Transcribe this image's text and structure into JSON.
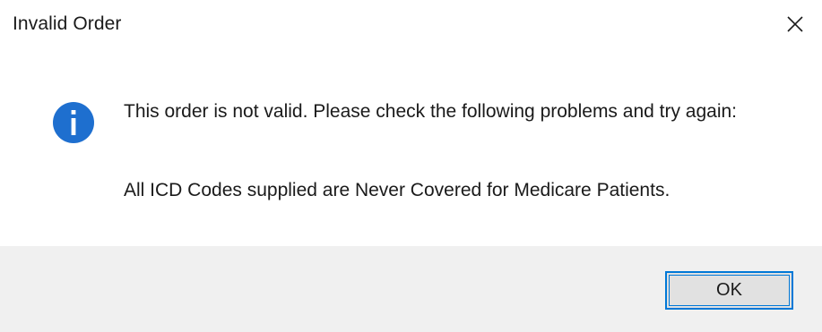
{
  "window": {
    "title": "Invalid Order",
    "close_icon": "close-icon"
  },
  "message": {
    "icon": "info-icon",
    "main_text": "This order is not valid.  Please check the following problems and try again:",
    "detail_text": "All ICD Codes supplied are Never Covered for Medicare Patients."
  },
  "footer": {
    "ok_label": "OK"
  },
  "colors": {
    "accent": "#0078d7",
    "info_icon": "#1e6fcf",
    "footer_bg": "#f0f0f0"
  }
}
